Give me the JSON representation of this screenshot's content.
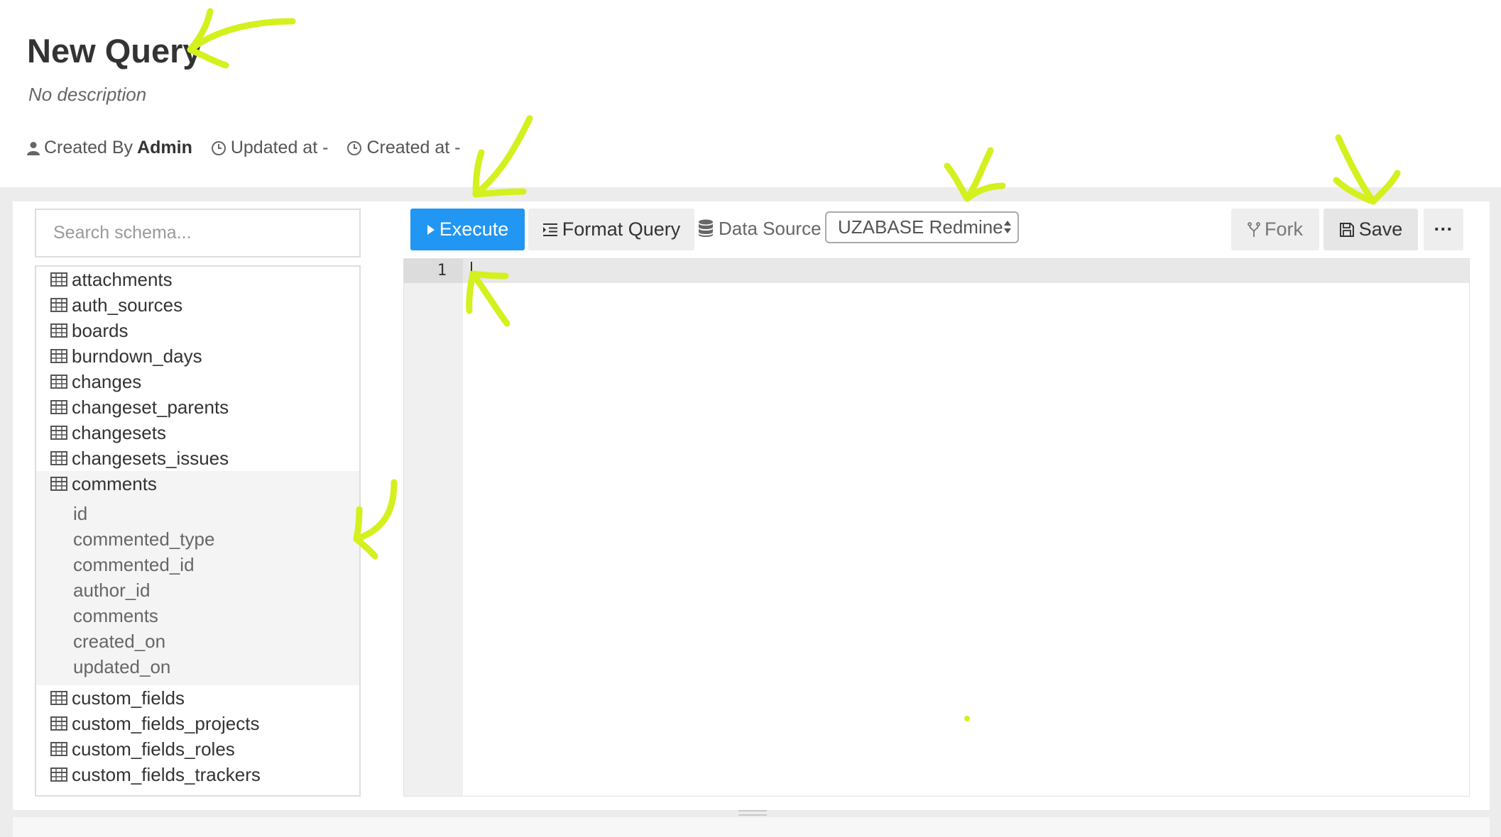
{
  "query": {
    "title": "New Query",
    "description": "No description",
    "created_by_label": "Created By",
    "created_by_user": "Admin",
    "updated_at": "Updated at -",
    "created_at": "Created at -"
  },
  "schema": {
    "search_placeholder": "Search schema...",
    "tables_before": [
      "attachments",
      "auth_sources",
      "boards",
      "burndown_days",
      "changes",
      "changeset_parents",
      "changesets",
      "changesets_issues"
    ],
    "open_table": {
      "name": "comments",
      "columns": [
        "id",
        "commented_type",
        "commented_id",
        "author_id",
        "comments",
        "created_on",
        "updated_on"
      ]
    },
    "tables_after": [
      "custom_fields",
      "custom_fields_projects",
      "custom_fields_roles",
      "custom_fields_trackers"
    ]
  },
  "toolbar": {
    "execute_label": "Execute",
    "format_label": "Format Query",
    "data_source_label": "Data Source",
    "data_source_value": "UZABASE Redmine",
    "fork_label": "Fork",
    "save_label": "Save",
    "more_label": "···"
  },
  "editor": {
    "line_numbers": [
      "1"
    ],
    "content": ""
  },
  "colors": {
    "primary": "#2196f3",
    "annotation": "#d4f01e"
  }
}
